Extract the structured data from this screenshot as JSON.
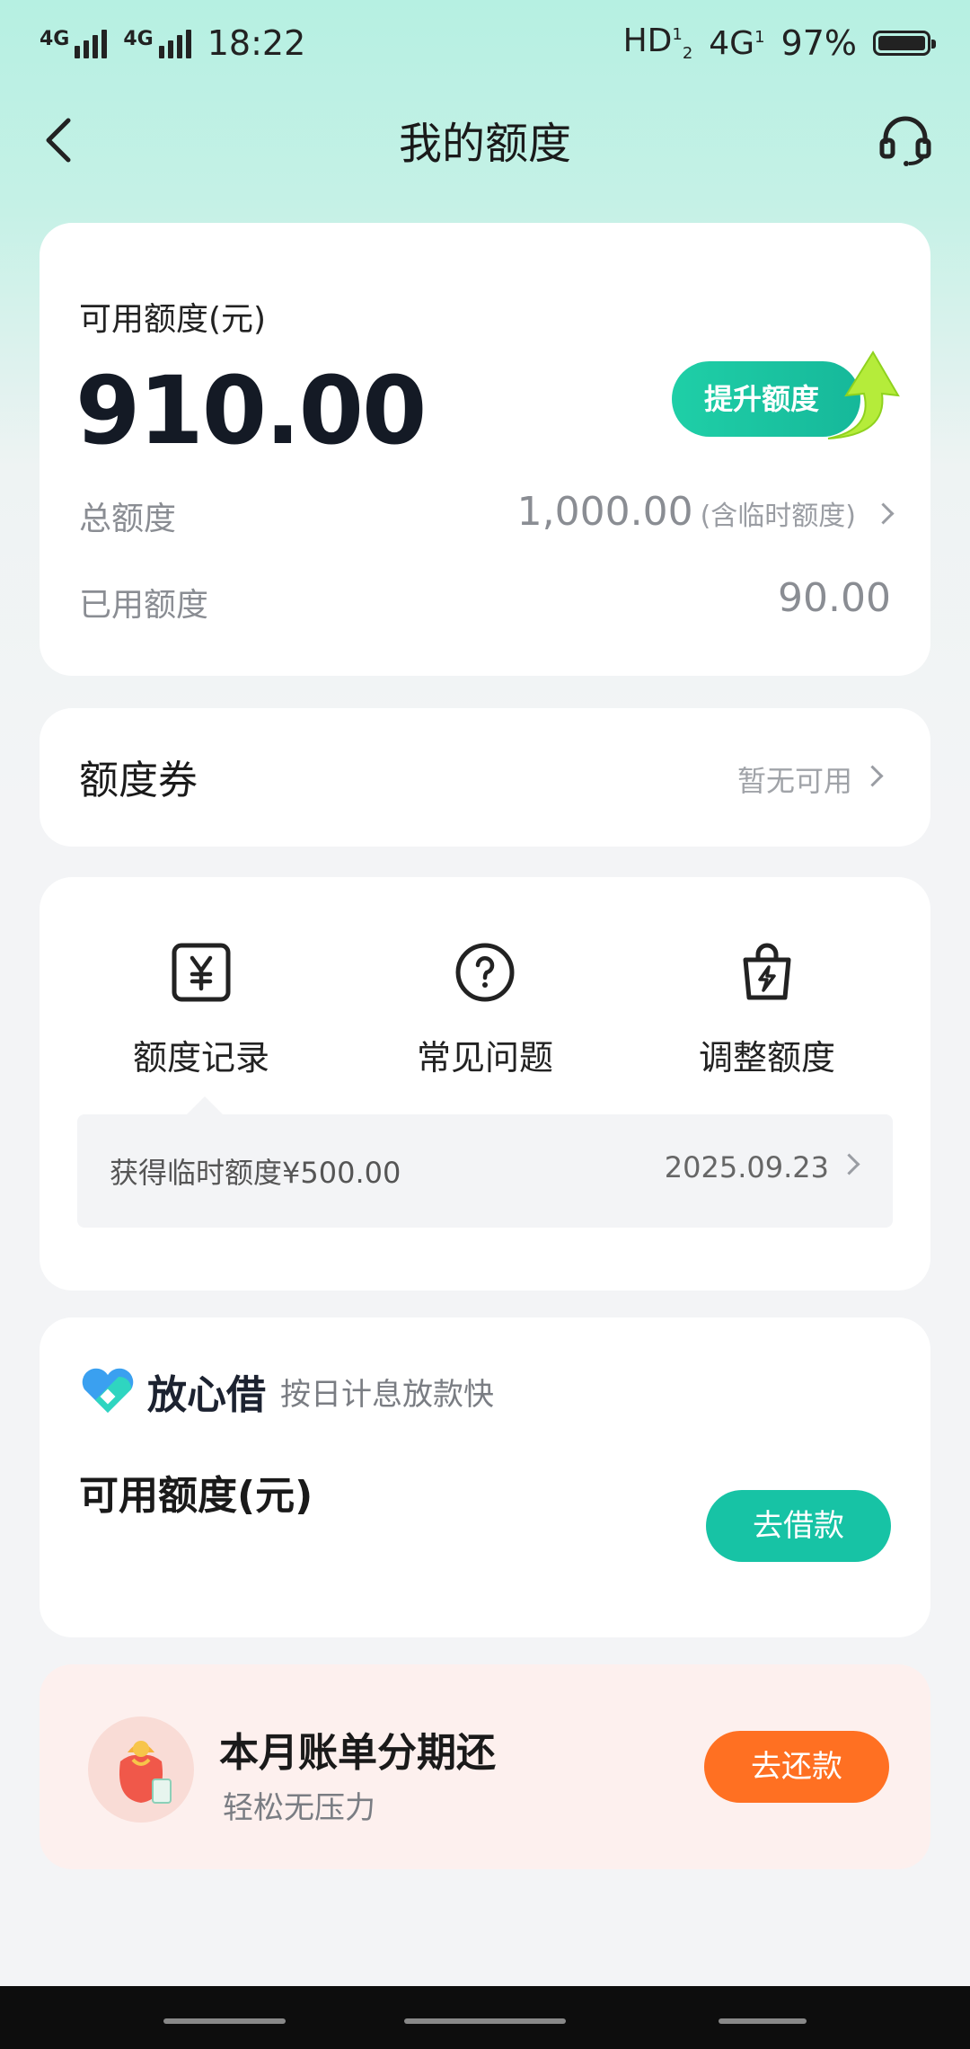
{
  "status": {
    "time": "18:22",
    "net1": "4G",
    "net2": "4G",
    "hd": "HD",
    "net3": "4G",
    "battery": "97%"
  },
  "header": {
    "title": "我的额度"
  },
  "quota": {
    "available_label": "可用额度(元)",
    "available_value": "910.00",
    "raise_button": "提升额度",
    "total_label": "总额度",
    "total_value": "1,000.00",
    "total_note": "(含临时额度)",
    "used_label": "已用额度",
    "used_value": "90.00"
  },
  "coupon": {
    "title": "额度券",
    "status": "暂无可用"
  },
  "features": [
    {
      "label": "额度记录",
      "icon": "yen-icon"
    },
    {
      "label": "常见问题",
      "icon": "question-icon"
    },
    {
      "label": "调整额度",
      "icon": "bag-bolt-icon"
    }
  ],
  "record": {
    "text": "获得临时额度¥500.00",
    "date": "2025.09.23"
  },
  "loan": {
    "brand": "放心借",
    "slogan": "按日计息放款快",
    "available_label": "可用额度(元)",
    "button": "去借款"
  },
  "bill": {
    "title": "本月账单分期还",
    "subtitle": "轻松无压力",
    "button": "去还款"
  },
  "colors": {
    "accent": "#17c3a5",
    "orange": "#ff7022"
  }
}
